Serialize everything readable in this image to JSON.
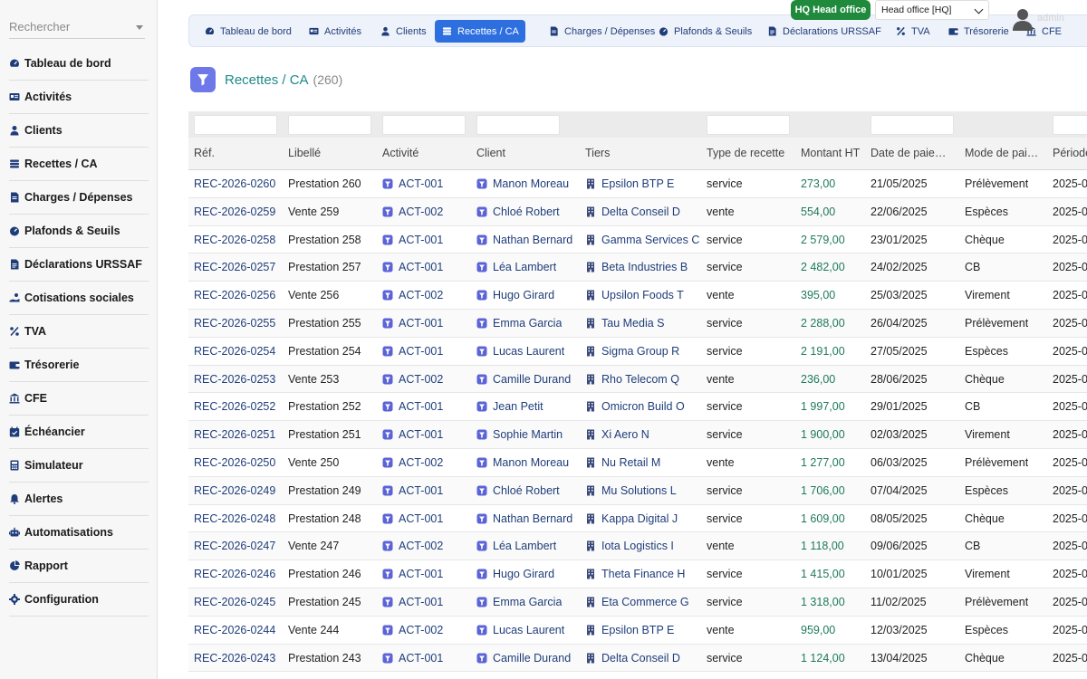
{
  "sidebar": {
    "search_placeholder": "Rechercher",
    "items": [
      {
        "label": "Tableau de bord",
        "icon": "dashboard-icon"
      },
      {
        "label": "Activités",
        "icon": "id-card-icon"
      },
      {
        "label": "Clients",
        "icon": "user-icon"
      },
      {
        "label": "Recettes / CA",
        "icon": "coins-icon"
      },
      {
        "label": "Charges / Dépenses",
        "icon": "file-invoice-icon"
      },
      {
        "label": "Plafonds & Seuils",
        "icon": "gauge-icon"
      },
      {
        "label": "Déclarations URSSAF",
        "icon": "file-icon"
      },
      {
        "label": "Cotisations sociales",
        "icon": "hand-coins-icon"
      },
      {
        "label": "TVA",
        "icon": "percent-icon"
      },
      {
        "label": "Trésorerie",
        "icon": "wallet-icon"
      },
      {
        "label": "CFE",
        "icon": "bank-icon"
      },
      {
        "label": "Échéancier",
        "icon": "calendar-icon"
      },
      {
        "label": "Simulateur",
        "icon": "calculator-icon"
      },
      {
        "label": "Alertes",
        "icon": "bell-icon"
      },
      {
        "label": "Automatisations",
        "icon": "robot-icon"
      },
      {
        "label": "Rapport",
        "icon": "pie-chart-icon"
      },
      {
        "label": "Configuration",
        "icon": "gear-icon"
      }
    ]
  },
  "topbar": {
    "tabs": [
      {
        "label": "Tableau de bord",
        "icon": "dashboard-icon"
      },
      {
        "label": "Activités",
        "icon": "id-card-icon"
      },
      {
        "label": "Clients",
        "icon": "user-icon"
      },
      {
        "label": "Recettes / CA",
        "icon": "coins-icon",
        "active": true
      },
      {
        "label": "Charges / Dépenses",
        "icon": "file-invoice-icon"
      },
      {
        "label": "Plafonds & Seuils",
        "icon": "gauge-icon"
      },
      {
        "label": "Déclarations URSSAF",
        "icon": "file-icon"
      },
      {
        "label": "TVA",
        "icon": "percent-icon"
      },
      {
        "label": "Trésorerie",
        "icon": "wallet-icon"
      },
      {
        "label": "CFE",
        "icon": "bank-icon"
      }
    ],
    "hq_button": "HQ Head office",
    "office_select": "Head office [HQ]",
    "user_label": "admin"
  },
  "page": {
    "title": "Recettes / CA",
    "count": "(260)"
  },
  "table": {
    "columns": [
      "Réf.",
      "Libellé",
      "Activité",
      "Client",
      "Tiers",
      "Type de recette",
      "Montant HT",
      "Date de paie…",
      "Mode de pai…",
      "Période"
    ],
    "rows": [
      {
        "ref": "REC-2026-0260",
        "libelle": "Prestation 260",
        "activite": "ACT-001",
        "client": "Manon Moreau",
        "tiers": "Epsilon BTP E",
        "type": "service",
        "montant": "273,00",
        "date": "21/05/2025",
        "mode": "Prélèvement",
        "periode": "2025-0"
      },
      {
        "ref": "REC-2026-0259",
        "libelle": "Vente 259",
        "activite": "ACT-002",
        "client": "Chloé Robert",
        "tiers": "Delta Conseil D",
        "type": "vente",
        "montant": "554,00",
        "date": "22/06/2025",
        "mode": "Espèces",
        "periode": "2025-0"
      },
      {
        "ref": "REC-2026-0258",
        "libelle": "Prestation 258",
        "activite": "ACT-001",
        "client": "Nathan Bernard",
        "tiers": "Gamma Services C",
        "type": "service",
        "montant": "2 579,00",
        "date": "23/01/2025",
        "mode": "Chèque",
        "periode": "2025-0"
      },
      {
        "ref": "REC-2026-0257",
        "libelle": "Prestation 257",
        "activite": "ACT-001",
        "client": "Léa Lambert",
        "tiers": "Beta Industries B",
        "type": "service",
        "montant": "2 482,00",
        "date": "24/02/2025",
        "mode": "CB",
        "periode": "2025-0"
      },
      {
        "ref": "REC-2026-0256",
        "libelle": "Vente 256",
        "activite": "ACT-002",
        "client": "Hugo Girard",
        "tiers": "Upsilon Foods T",
        "type": "vente",
        "montant": "395,00",
        "date": "25/03/2025",
        "mode": "Virement",
        "periode": "2025-0"
      },
      {
        "ref": "REC-2026-0255",
        "libelle": "Prestation 255",
        "activite": "ACT-001",
        "client": "Emma Garcia",
        "tiers": "Tau Media S",
        "type": "service",
        "montant": "2 288,00",
        "date": "26/04/2025",
        "mode": "Prélèvement",
        "periode": "2025-0"
      },
      {
        "ref": "REC-2026-0254",
        "libelle": "Prestation 254",
        "activite": "ACT-001",
        "client": "Lucas Laurent",
        "tiers": "Sigma Group R",
        "type": "service",
        "montant": "2 191,00",
        "date": "27/05/2025",
        "mode": "Espèces",
        "periode": "2025-0"
      },
      {
        "ref": "REC-2026-0253",
        "libelle": "Vente 253",
        "activite": "ACT-002",
        "client": "Camille Durand",
        "tiers": "Rho Telecom Q",
        "type": "vente",
        "montant": "236,00",
        "date": "28/06/2025",
        "mode": "Chèque",
        "periode": "2025-0"
      },
      {
        "ref": "REC-2026-0252",
        "libelle": "Prestation 252",
        "activite": "ACT-001",
        "client": "Jean Petit",
        "tiers": "Omicron Build O",
        "type": "service",
        "montant": "1 997,00",
        "date": "29/01/2025",
        "mode": "CB",
        "periode": "2025-0"
      },
      {
        "ref": "REC-2026-0251",
        "libelle": "Prestation 251",
        "activite": "ACT-001",
        "client": "Sophie Martin",
        "tiers": "Xi Aero N",
        "type": "service",
        "montant": "1 900,00",
        "date": "02/03/2025",
        "mode": "Virement",
        "periode": "2025-0"
      },
      {
        "ref": "REC-2026-0250",
        "libelle": "Vente 250",
        "activite": "ACT-002",
        "client": "Manon Moreau",
        "tiers": "Nu Retail M",
        "type": "vente",
        "montant": "1 277,00",
        "date": "06/03/2025",
        "mode": "Prélèvement",
        "periode": "2025-0"
      },
      {
        "ref": "REC-2026-0249",
        "libelle": "Prestation 249",
        "activite": "ACT-001",
        "client": "Chloé Robert",
        "tiers": "Mu Solutions L",
        "type": "service",
        "montant": "1 706,00",
        "date": "07/04/2025",
        "mode": "Espèces",
        "periode": "2025-0"
      },
      {
        "ref": "REC-2026-0248",
        "libelle": "Prestation 248",
        "activite": "ACT-001",
        "client": "Nathan Bernard",
        "tiers": "Kappa Digital J",
        "type": "service",
        "montant": "1 609,00",
        "date": "08/05/2025",
        "mode": "Chèque",
        "periode": "2025-0"
      },
      {
        "ref": "REC-2026-0247",
        "libelle": "Vente 247",
        "activite": "ACT-002",
        "client": "Léa Lambert",
        "tiers": "Iota Logistics I",
        "type": "vente",
        "montant": "1 118,00",
        "date": "09/06/2025",
        "mode": "CB",
        "periode": "2025-0"
      },
      {
        "ref": "REC-2026-0246",
        "libelle": "Prestation 246",
        "activite": "ACT-001",
        "client": "Hugo Girard",
        "tiers": "Theta Finance H",
        "type": "service",
        "montant": "1 415,00",
        "date": "10/01/2025",
        "mode": "Virement",
        "periode": "2025-0"
      },
      {
        "ref": "REC-2026-0245",
        "libelle": "Prestation 245",
        "activite": "ACT-001",
        "client": "Emma Garcia",
        "tiers": "Eta Commerce G",
        "type": "service",
        "montant": "1 318,00",
        "date": "11/02/2025",
        "mode": "Prélèvement",
        "periode": "2025-0"
      },
      {
        "ref": "REC-2026-0244",
        "libelle": "Vente 244",
        "activite": "ACT-002",
        "client": "Lucas Laurent",
        "tiers": "Epsilon BTP E",
        "type": "vente",
        "montant": "959,00",
        "date": "12/03/2025",
        "mode": "Espèces",
        "periode": "2025-0"
      },
      {
        "ref": "REC-2026-0243",
        "libelle": "Prestation 243",
        "activite": "ACT-001",
        "client": "Camille Durand",
        "tiers": "Delta Conseil D",
        "type": "service",
        "montant": "1 124,00",
        "date": "13/04/2025",
        "mode": "Chèque",
        "periode": "2025-0"
      }
    ]
  },
  "colors": {
    "accent": "#2e6fe0",
    "hq_green": "#1f8a3c",
    "amount_green": "#1f7a5a",
    "link_navy": "#1f3d7a",
    "title_teal": "#1d8a8a"
  }
}
